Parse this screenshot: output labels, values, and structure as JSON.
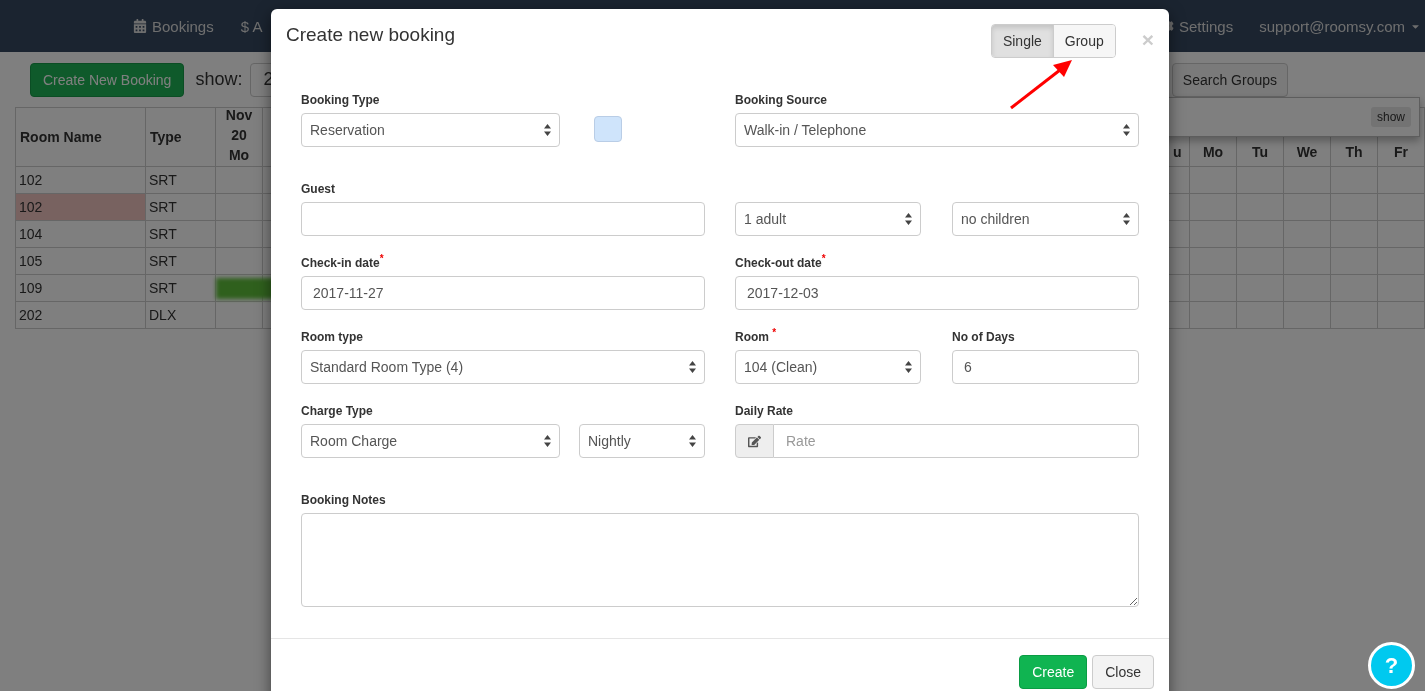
{
  "navbar": {
    "items": [
      {
        "label": "Bookings"
      },
      {
        "label": "$ A"
      }
    ],
    "right_items": [
      {
        "label": "Settings"
      },
      {
        "label": "support@roomsy.com"
      }
    ]
  },
  "toolbar": {
    "create_button": "Create New Booking",
    "show_label": "show:",
    "show_value": "2",
    "search_groups": "Search Groups",
    "popover_button": "show"
  },
  "table": {
    "left_columns": [
      "Room Name",
      "Type",
      "Nov 20 Mo"
    ],
    "right_columns": [
      "u",
      "Mo",
      "Tu",
      "We",
      "Th",
      "Fr"
    ],
    "rows": [
      {
        "room": "102",
        "type": "SRT"
      },
      {
        "room": "102",
        "type": "SRT",
        "highlighted": true
      },
      {
        "room": "104",
        "type": "SRT"
      },
      {
        "room": "105",
        "type": "SRT"
      },
      {
        "room": "109",
        "type": "SRT",
        "booking": true
      },
      {
        "room": "202",
        "type": "DLX"
      }
    ]
  },
  "modal": {
    "title": "Create new booking",
    "close": "×",
    "toggle": [
      {
        "label": "Single",
        "selected": true
      },
      {
        "label": "Group",
        "selected": false
      }
    ],
    "rows": [
      [
        {
          "kind": "select",
          "label": "Booking Type",
          "value": "Reservation"
        },
        {
          "kind": "color",
          "color": "#cfe4fb"
        },
        {
          "kind": "select",
          "label": "Booking Source",
          "value": "Walk-in / Telephone"
        }
      ],
      [
        {
          "kind": "input",
          "label": "Guest"
        },
        {
          "kind": "select",
          "value": "1 adult"
        },
        {
          "kind": "select",
          "value": "no children"
        }
      ],
      [
        {
          "kind": "input",
          "label": "Check-in date$^{*}$",
          "value": "2017-11-27"
        },
        {
          "kind": "input",
          "label": "Check-out date$^{*}$",
          "value": "2017-12-03"
        }
      ],
      [
        {
          "kind": "select",
          "label": "Room type",
          "value": "Standard Room Type (4)"
        },
        {
          "kind": "select",
          "label": "Room $^{*}$",
          "value": "104 (Clean)"
        },
        {
          "kind": "input",
          "label": "No of Days",
          "value": "6"
        }
      ],
      [
        {
          "kind": "select",
          "label": "Charge Type",
          "value": "Room Charge"
        },
        {
          "kind": "select",
          "value": "Nightly"
        },
        {
          "kind": "addon",
          "label": "Daily Rate",
          "placeholder": "Rate"
        }
      ],
      [
        {
          "kind": "textarea",
          "label": "Booking Notes"
        }
      ]
    ],
    "buttons": [
      {
        "kind": "primary",
        "label": "Create"
      },
      {
        "kind": "default",
        "label": "Close"
      }
    ]
  },
  "help_button": {
    "label": "?"
  }
}
